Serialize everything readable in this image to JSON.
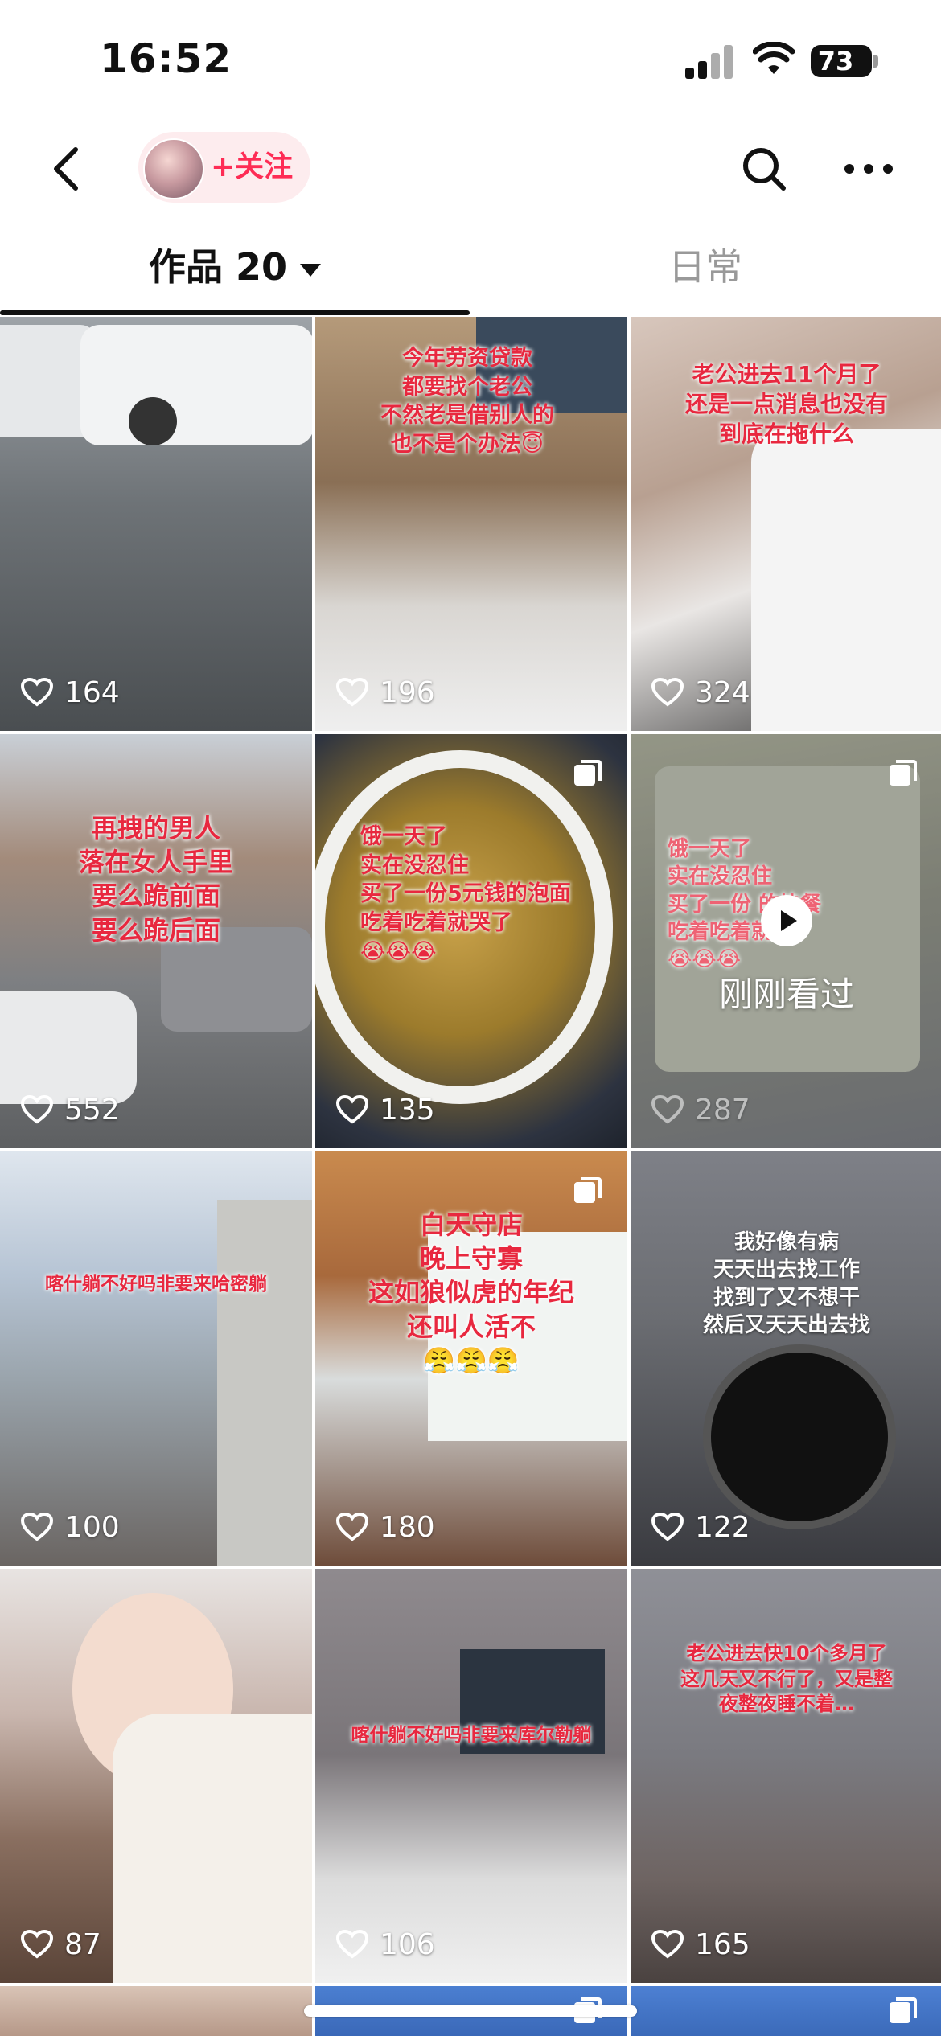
{
  "status_bar": {
    "time": "16:52",
    "battery": "73"
  },
  "nav": {
    "follow_label": "+关注"
  },
  "tabs": {
    "works_label": "作品 20",
    "daily_label": "日常"
  },
  "grid": {
    "tiles": [
      {
        "likes": "164",
        "caption": ""
      },
      {
        "likes": "196",
        "caption": "今年劳资贷款\n都要找个老公\n不然老是借别人的\n也不是个办法😇"
      },
      {
        "likes": "324",
        "caption": "老公进去11个月了\n还是一点消息也没有\n到底在拖什么"
      },
      {
        "likes": "552",
        "caption": "再拽的男人\n落在女人手里\n要么跪前面\n要么跪后面"
      },
      {
        "likes": "135",
        "caption": "饿一天了\n实在没忍住\n买了一份5元钱的泡面\n吃着吃着就哭了\n😭😭😭"
      },
      {
        "likes": "287",
        "caption": "饿一天了\n实在没忍住\n买了一份   的快餐\n吃着吃着就\n😭😭😭",
        "watched_label": "刚刚看过"
      },
      {
        "likes": "100",
        "caption": "喀什躺不好吗非要来哈密躺"
      },
      {
        "likes": "180",
        "caption": "白天守店\n晚上守寡\n这如狼似虎的年纪\n还叫人活不\n😤😤😤"
      },
      {
        "likes": "122",
        "caption": "我好像有病\n天天出去找工作\n找到了又不想干\n然后又天天出去找"
      },
      {
        "likes": "87",
        "caption": ""
      },
      {
        "likes": "106",
        "caption": "喀什躺不好吗非要来库尔勒躺"
      },
      {
        "likes": "165",
        "caption": "老公进去快10个多月了\n这几天又不行了，又是整\n夜整夜睡不着…"
      }
    ]
  },
  "colors": {
    "accent": "#fe2c55",
    "caption_red": "#e8283f"
  },
  "icons": [
    "back-icon",
    "search-icon",
    "more-icon",
    "heart-icon",
    "multi-image-icon",
    "play-icon"
  ]
}
